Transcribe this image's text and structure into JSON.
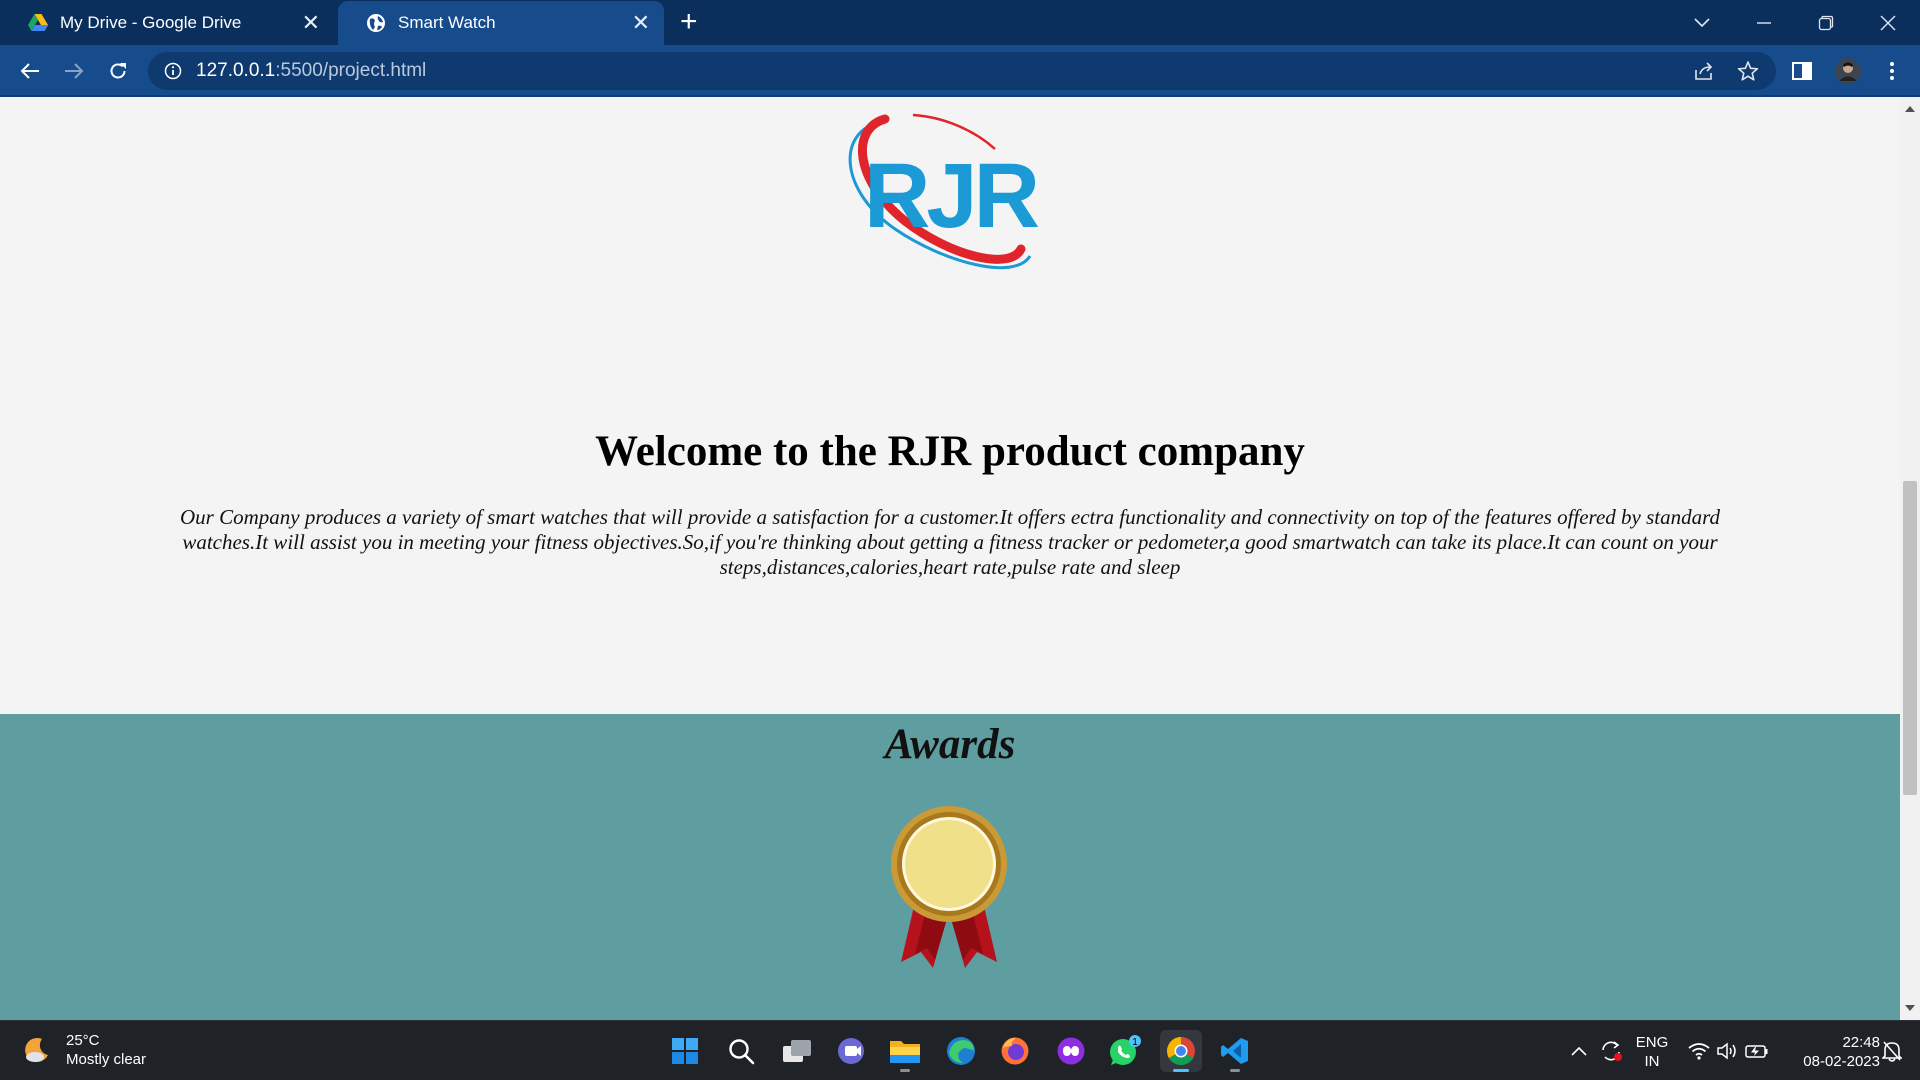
{
  "browser": {
    "tabs": [
      {
        "title": "My Drive - Google Drive",
        "active": false,
        "icon": "google-drive-icon"
      },
      {
        "title": "Smart Watch",
        "active": true,
        "icon": "globe-icon"
      }
    ],
    "url_host": "127.0.0.1",
    "url_rest": ":5500/project.html"
  },
  "page": {
    "logo_text": "RJR",
    "welcome_heading": "Welcome to the RJR product company",
    "intro_text": "Our Company produces a variety of smart watches that will provide a satisfaction for a customer.It offers ectra functionality and connectivity on top of the features offered by standard watches.It will assist you in meeting your fitness objectives.So,if you're thinking about getting a fitness tracker or pedometer,a good smartwatch can take its place.It can count on your steps,distances,calories,heart rate,pulse rate and sleep",
    "awards_heading": "Awards",
    "colors": {
      "awards_bg": "#5f9ea0",
      "logo_blue": "#1b9ad6",
      "logo_red": "#e0242c"
    }
  },
  "taskbar": {
    "weather_temp": "25°C",
    "weather_desc": "Mostly clear",
    "apps": [
      "start-icon",
      "search-icon",
      "task-view-icon",
      "chat-icon",
      "file-explorer-icon",
      "edge-icon",
      "firefox-icon",
      "game-app-icon",
      "whatsapp-icon",
      "chrome-icon",
      "vscode-icon"
    ],
    "whatsapp_badge": "1",
    "lang_line1": "ENG",
    "lang_line2": "IN",
    "time": "22:48",
    "date": "08-02-2023"
  }
}
